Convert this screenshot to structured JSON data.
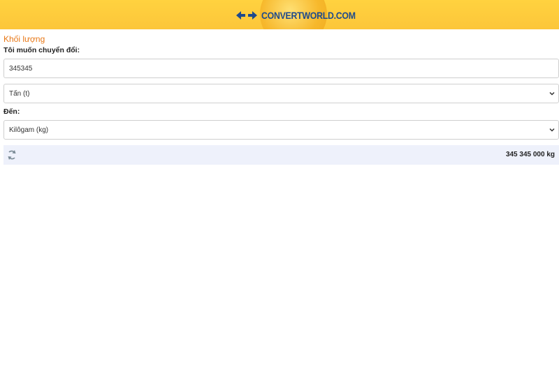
{
  "header": {
    "logo_text": "CONVERTWORLD.COM",
    "logo_icon": "double-arrow-icon"
  },
  "converter": {
    "category_title": "Khối lượng",
    "from_label": "Tôi muốn chuyển đổi:",
    "amount_value": "345345",
    "from_unit": "Tấn (t)",
    "to_label": "Đến:",
    "to_unit": "Kilôgam (kg)",
    "result": "345 345 000 kg"
  },
  "icons": {
    "refresh": "refresh-icon",
    "dropdown": "chevron-down-icon"
  },
  "colors": {
    "header_bg": "#fcc63a",
    "logo_blue": "#1e4a8c",
    "title_orange": "#e87817",
    "result_bg": "#eef1fb"
  }
}
